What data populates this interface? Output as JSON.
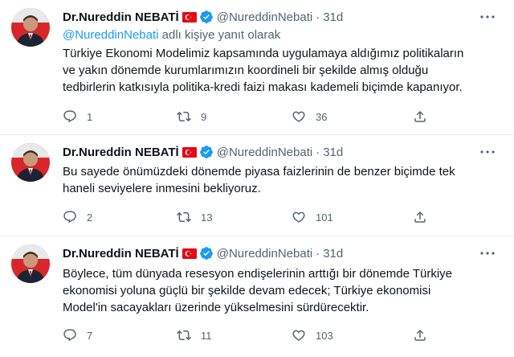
{
  "tweets": [
    {
      "name": "Dr.Nureddin NEBATİ",
      "handle": "@NureddinNebati",
      "separator": "·",
      "time": "31d",
      "reply_mention": "@NureddinNebati",
      "reply_suffix": " adlı kişiye yanıt olarak",
      "lines": [
        "Türkiye Ekonomi Modelimiz kapsamında uygulamaya aldığımız politikaların",
        "ve yakın dönemde kurumlarımızın koordineli bir şekilde almış olduğu",
        "tedbirlerin katkısıyla politika-kredi faizi makası kademeli biçimde kapanıyor."
      ],
      "replies": "1",
      "retweets": "9",
      "likes": "36"
    },
    {
      "name": "Dr.Nureddin NEBATİ",
      "handle": "@NureddinNebati",
      "separator": "·",
      "time": "31d",
      "lines": [
        "Bu sayede önümüzdeki dönemde piyasa faizlerinin de benzer biçimde tek",
        "haneli seviyelere inmesini bekliyoruz."
      ],
      "replies": "2",
      "retweets": "13",
      "likes": "101"
    },
    {
      "name": "Dr.Nureddin NEBATİ",
      "handle": "@NureddinNebati",
      "separator": "·",
      "time": "31d",
      "lines": [
        "Böylece, tüm dünyada resesyon endişelerinin arttığı bir dönemde Türkiye",
        "ekonomisi yoluna güçlü bir şekilde devam edecek; Türkiye ekonomisi",
        "Model'in sacayakları üzerinde yükselmesini sürdürecektir."
      ],
      "replies": "7",
      "retweets": "11",
      "likes": "103"
    }
  ],
  "icons": {
    "reply": "reply-icon",
    "retweet": "retweet-icon",
    "like": "heart-icon",
    "share": "share-icon",
    "more": "more-options-icon",
    "verified": "verified-badge-icon",
    "flag": "turkey-flag-icon"
  },
  "colors": {
    "verified": "#1d9bf0",
    "flag": "#e30a17",
    "muted": "#536471",
    "text": "#0f1419",
    "mention": "#1d9bf0"
  }
}
